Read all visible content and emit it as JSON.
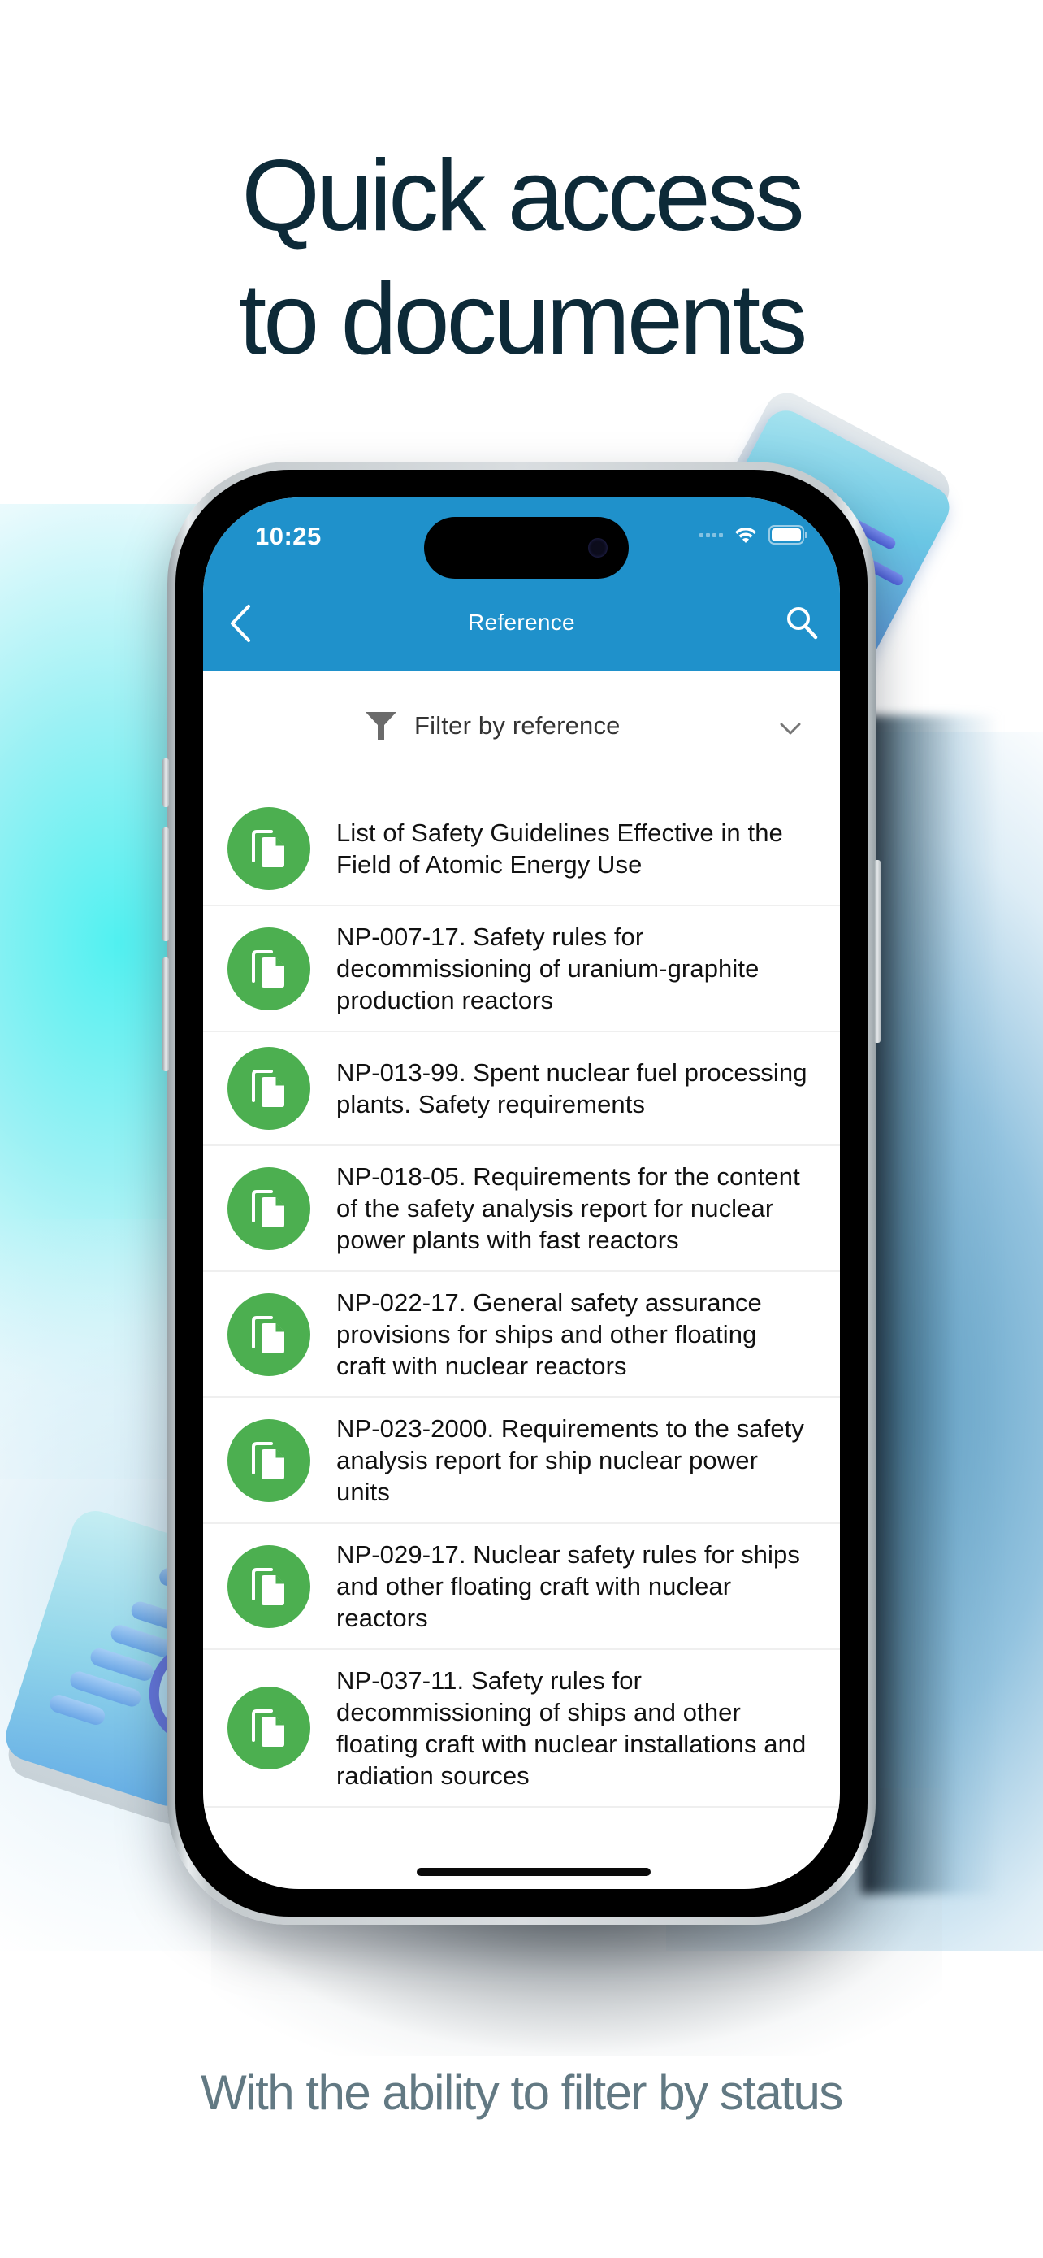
{
  "headline": {
    "line1": "Quick access",
    "line2": "to documents"
  },
  "subline": "With the ability to filter by status",
  "colors": {
    "headline": "#0d2a38",
    "subline": "#627983",
    "appbar": "#1f91cb",
    "doc_icon_bg": "#4caf50",
    "separator": "#efefef"
  },
  "status_bar": {
    "time": "10:25",
    "icons": [
      "signal-icon",
      "wifi-icon",
      "battery-icon"
    ]
  },
  "nav": {
    "back_icon": "chevron-left-icon",
    "title": "Reference",
    "search_icon": "search-icon"
  },
  "filter": {
    "icon": "filter-funnel-icon",
    "label": "Filter by reference",
    "chevron_icon": "chevron-down-icon"
  },
  "documents": [
    {
      "icon": "document-copy-icon",
      "title": "List of Safety Guidelines Effective in the Field of Atomic Energy Use"
    },
    {
      "icon": "document-copy-icon",
      "title": "NP-007-17. Safety rules for decommissioning of uranium-graphite production reactors"
    },
    {
      "icon": "document-copy-icon",
      "title": "NP-013-99. Spent nuclear fuel processing plants. Safety requirements"
    },
    {
      "icon": "document-copy-icon",
      "title": "NP-018-05. Requirements for the content of the safety analysis report for nuclear power plants with fast reactors"
    },
    {
      "icon": "document-copy-icon",
      "title": "NP-022-17. General safety assurance provisions for ships and other floating craft with nuclear reactors"
    },
    {
      "icon": "document-copy-icon",
      "title": "NP-023-2000. Requirements to the safety analysis report for ship nuclear power units"
    },
    {
      "icon": "document-copy-icon",
      "title": "NP-029-17. Nuclear safety rules for ships and other floating craft with nuclear reactors"
    },
    {
      "icon": "document-copy-icon",
      "title": "NP-037-11. Safety rules for decommissioning of ships and other floating craft with nuclear installations and radiation sources"
    }
  ]
}
